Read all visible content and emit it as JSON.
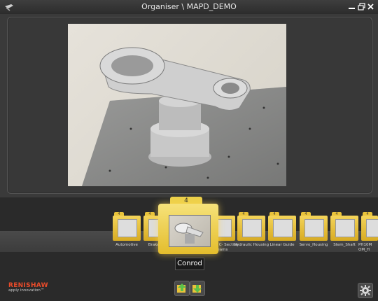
{
  "window": {
    "title": "Organiser \\ MAPD_DEMO"
  },
  "selected": {
    "label": "Conrod",
    "count": "4"
  },
  "folders": [
    {
      "label": "Automotive",
      "count": "4"
    },
    {
      "label": "Brake C...",
      "count": "4"
    },
    {
      "label": "Curved C- Section Beams",
      "count": "4"
    },
    {
      "label": "Hydraulic Housing",
      "count": "4"
    },
    {
      "label": "Linear Guide",
      "count": "4"
    },
    {
      "label": "Servo_Housing",
      "count": "4"
    },
    {
      "label": "Stem_Shaft",
      "count": "4"
    },
    {
      "label": "PH10M OM_H",
      "count": "4"
    }
  ],
  "brand": {
    "name": "RENISHAW",
    "tagline": "apply innovation™"
  },
  "icons": {
    "app": "probe-icon",
    "minimize": "minimize-icon",
    "maximize": "maximize-icon",
    "close": "close-icon",
    "settings": "settings-gear-icon"
  },
  "colors": {
    "folder": "#e9c33a",
    "brand": "#e84b2a",
    "background": "#3a3a3a"
  }
}
